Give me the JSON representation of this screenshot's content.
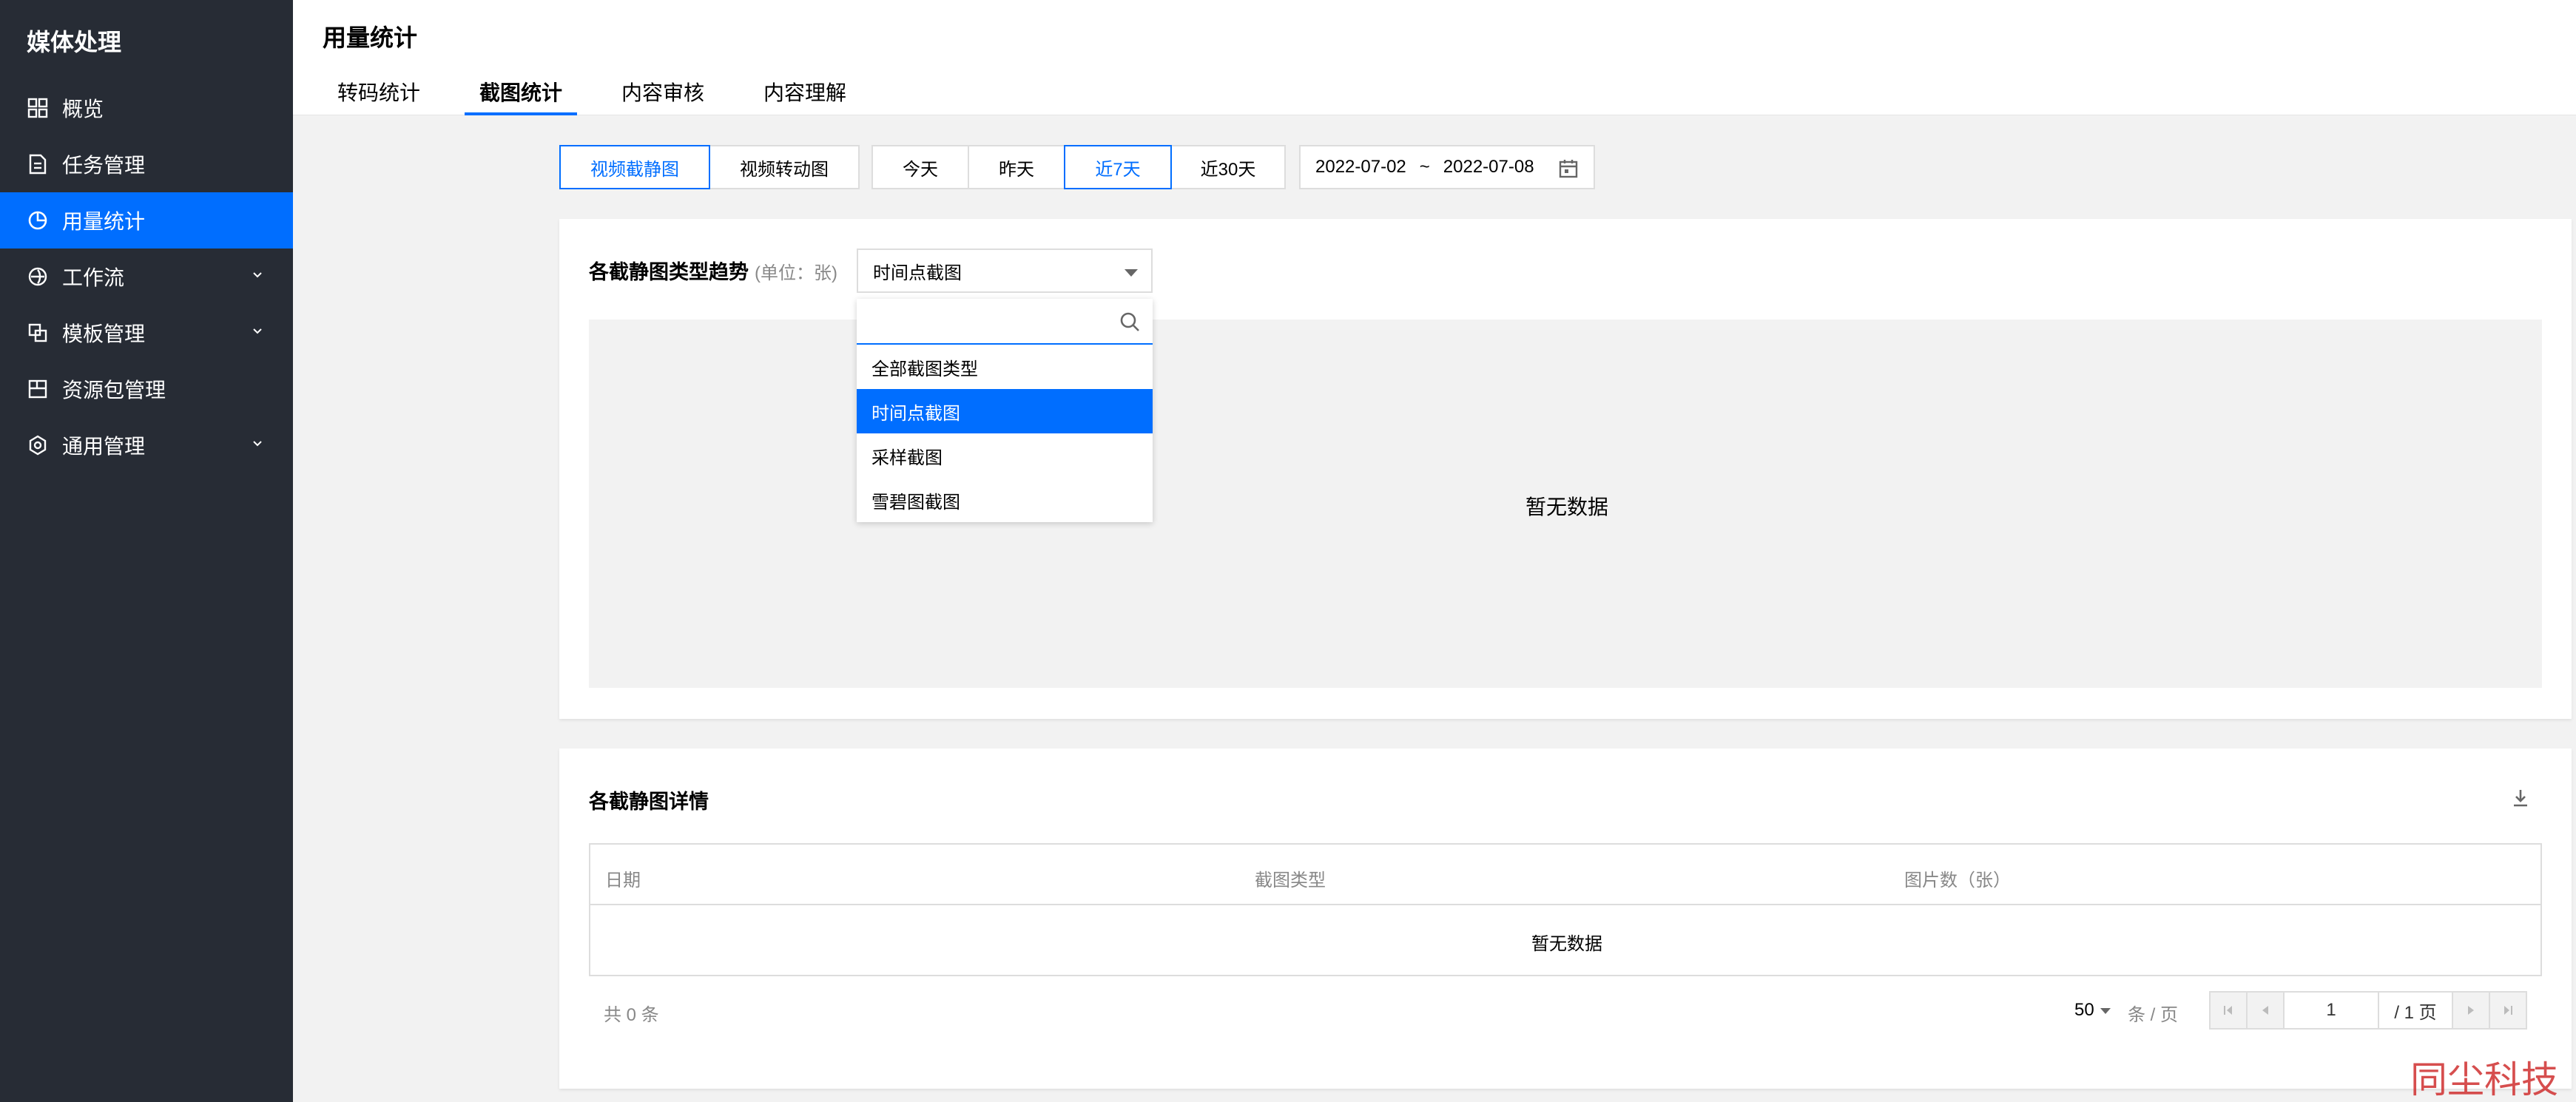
{
  "sidebar": {
    "title": "媒体处理",
    "items": [
      {
        "label": "概览",
        "icon": "grid-icon",
        "active": false,
        "has_children": false
      },
      {
        "label": "任务管理",
        "icon": "document-icon",
        "active": false,
        "has_children": false
      },
      {
        "label": "用量统计",
        "icon": "pie-chart-icon",
        "active": true,
        "has_children": false
      },
      {
        "label": "工作流",
        "icon": "workflow-icon",
        "active": false,
        "has_children": true
      },
      {
        "label": "模板管理",
        "icon": "template-icon",
        "active": false,
        "has_children": true
      },
      {
        "label": "资源包管理",
        "icon": "package-icon",
        "active": false,
        "has_children": false
      },
      {
        "label": "通用管理",
        "icon": "gear-icon",
        "active": false,
        "has_children": true
      }
    ]
  },
  "header": {
    "title": "用量统计",
    "tabs": [
      {
        "label": "转码统计",
        "active": false
      },
      {
        "label": "截图统计",
        "active": true
      },
      {
        "label": "内容审核",
        "active": false
      },
      {
        "label": "内容理解",
        "active": false
      }
    ]
  },
  "filters": {
    "type_buttons": [
      {
        "label": "视频截静图",
        "selected": true
      },
      {
        "label": "视频转动图",
        "selected": false
      }
    ],
    "range_buttons": [
      {
        "label": "今天",
        "selected": false
      },
      {
        "label": "昨天",
        "selected": false
      },
      {
        "label": "近7天",
        "selected": true
      },
      {
        "label": "近30天",
        "selected": false
      }
    ],
    "date_start": "2022-07-02",
    "date_sep": "~",
    "date_end": "2022-07-08"
  },
  "trend_panel": {
    "title": "各截静图类型趋势",
    "unit": "(单位：张)",
    "select_value": "时间点截图",
    "empty_text": "暂无数据",
    "dropdown": {
      "search_value": "",
      "options": [
        {
          "label": "全部截图类型",
          "selected": false
        },
        {
          "label": "时间点截图",
          "selected": true
        },
        {
          "label": "采样截图",
          "selected": false
        },
        {
          "label": "雪碧图截图",
          "selected": false
        }
      ]
    }
  },
  "detail_panel": {
    "title": "各截静图详情",
    "columns": [
      "日期",
      "截图类型",
      "图片数（张）"
    ],
    "empty_text": "暂无数据",
    "total_text": "共  0  条",
    "page_size": "50",
    "per_page_text": "条 / 页",
    "current_page": "1",
    "total_pages_text": "/ 1 页"
  },
  "watermark": "同尘科技",
  "colors": {
    "sidebar_bg": "#272c35",
    "accent": "#006eff",
    "page_bg": "#f2f2f2"
  }
}
